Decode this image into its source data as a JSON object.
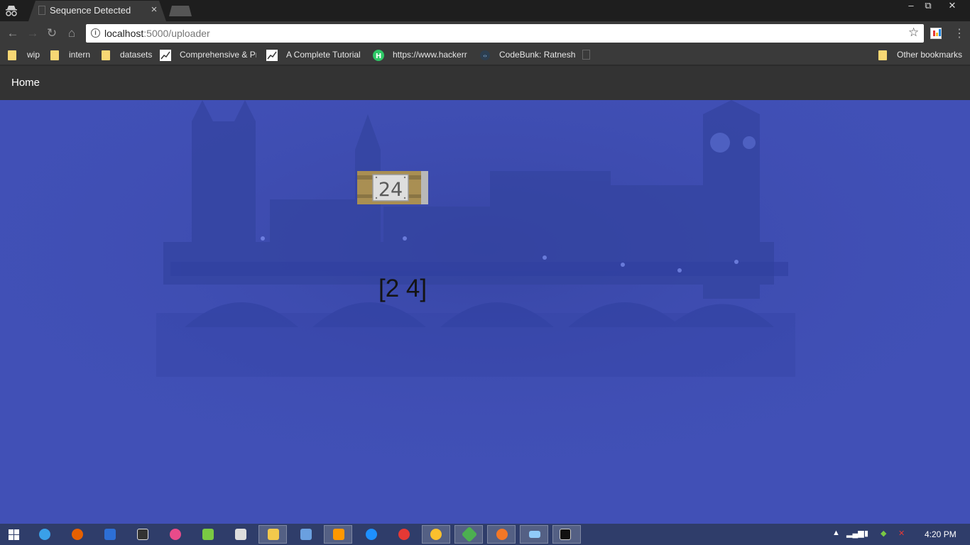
{
  "browser": {
    "tab_title": "Sequence Detected",
    "tab_close": "×",
    "window_controls": {
      "minimize": "–",
      "maximize": "⧉",
      "close": "✕"
    },
    "url_host": "localhost",
    "url_path": ":5000/uploader",
    "icons": [
      "incognito-icon",
      "back-icon",
      "forward-icon",
      "reload-icon",
      "home-icon",
      "info-icon",
      "star-icon",
      "extension-icon",
      "menu-icon"
    ]
  },
  "bookmarks": {
    "items": [
      {
        "label": "wip",
        "icon": "folder-icon"
      },
      {
        "label": "intern",
        "icon": "folder-icon"
      },
      {
        "label": "datasets",
        "icon": "folder-icon"
      },
      {
        "label": "Comprehensive & Pr",
        "icon": "chart-favicon"
      },
      {
        "label": "A Complete Tutorial",
        "icon": "chart-favicon"
      },
      {
        "label": "https://www.hackerr",
        "icon": "hackerrank-favicon"
      },
      {
        "label": "CodeBunk: Ratnesh",
        "icon": "codebunk-favicon"
      }
    ],
    "other": "Other bookmarks"
  },
  "page": {
    "nav_home": "Home",
    "plate_text": "24",
    "result": "[2 4]"
  },
  "taskbar": {
    "clock": "4:20 PM",
    "colors": {
      "taskbar": "#2f3d6a",
      "page_background": "#4150b6"
    }
  }
}
